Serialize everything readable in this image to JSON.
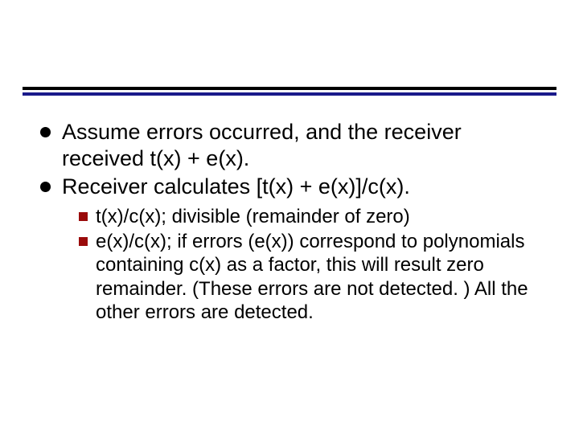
{
  "bullets": [
    {
      "text": "Assume errors occurred, and the receiver received t(x) + e(x)."
    },
    {
      "text": "Receiver calculates [t(x) + e(x)]/c(x)."
    }
  ],
  "subbullets": [
    {
      "text": "t(x)/c(x); divisible (remainder of zero)"
    },
    {
      "text": "e(x)/c(x); if errors (e(x)) correspond to polynomials containing c(x) as a factor, this will result zero remainder.  (These errors are not detected. )   All the other errors are detected."
    }
  ],
  "colors": {
    "rule_top": "#000000",
    "rule_bottom": "#1a1a8a",
    "sub_square": "#9a0a0a"
  }
}
